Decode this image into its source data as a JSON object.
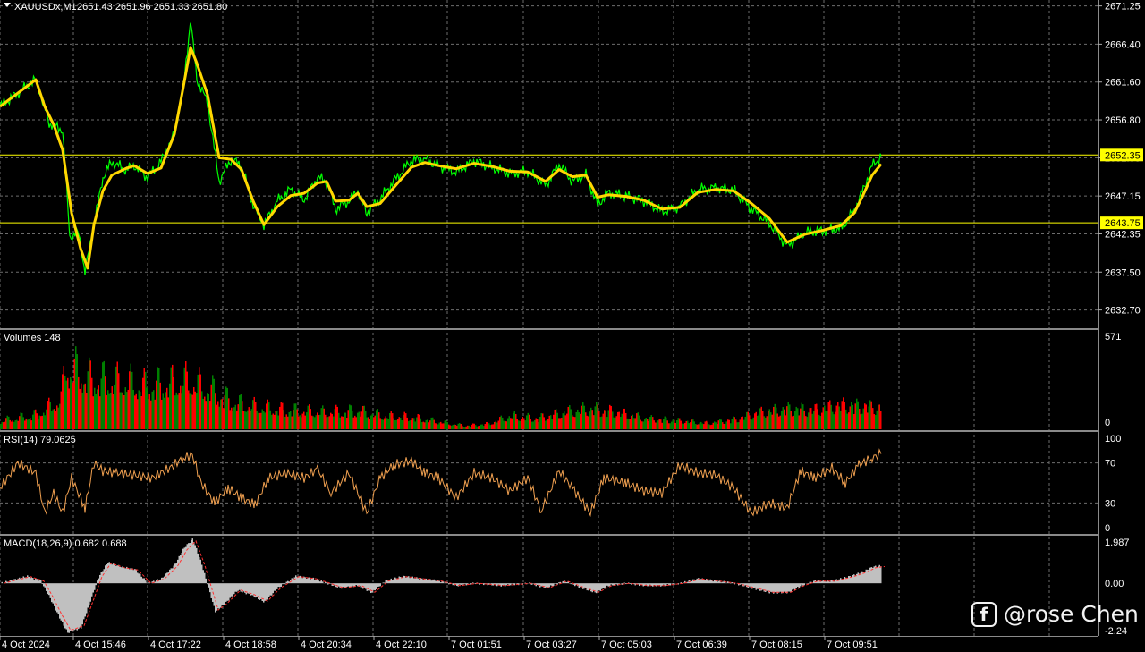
{
  "chart_data": [
    {
      "type": "line",
      "panel": "price",
      "header": {
        "symbol": "XAUUSDx,M1",
        "ohlc": "2651.43 2651.96 2651.33 2651.80"
      },
      "ylim": [
        2630.5,
        2672.0
      ],
      "y_ticks": [
        "2671.25",
        "2666.40",
        "2661.60",
        "2656.80",
        "2652.00",
        "2647.15",
        "2642.35",
        "2637.50",
        "2632.70"
      ],
      "x_ticks": [
        "4 Oct 2024",
        "4 Oct 15:46",
        "4 Oct 17:22",
        "4 Oct 18:58",
        "4 Oct 20:34",
        "4 Oct 22:10",
        "7 Oct 01:51",
        "7 Oct 03:27",
        "7 Oct 05:03",
        "7 Oct 06:39",
        "7 Oct 08:15",
        "7 Oct 09:51"
      ],
      "levels": [
        {
          "label": "2652.35",
          "value": 2652.35,
          "color": "#ffff00"
        },
        {
          "label": "2643.75",
          "value": 2643.75,
          "color": "#ffff00"
        }
      ],
      "series": [
        {
          "role": "price",
          "color": "#00ff00",
          "points": [
            [
              0,
              2658.5
            ],
            [
              40,
              2661.9
            ],
            [
              55,
              2656.4
            ],
            [
              70,
              2655.5
            ],
            [
              78,
              2642.0
            ],
            [
              88,
              2642.5
            ],
            [
              95,
              2637.5
            ],
            [
              105,
              2643.5
            ],
            [
              115,
              2649.5
            ],
            [
              125,
              2651.5
            ],
            [
              140,
              2650.5
            ],
            [
              150,
              2651.0
            ],
            [
              165,
              2649.5
            ],
            [
              180,
              2651.5
            ],
            [
              195,
              2655.0
            ],
            [
              205,
              2661.0
            ],
            [
              213,
              2669.5
            ],
            [
              220,
              2662.0
            ],
            [
              232,
              2659.0
            ],
            [
              245,
              2649.0
            ],
            [
              258,
              2651.8
            ],
            [
              270,
              2651.0
            ],
            [
              283,
              2646.0
            ],
            [
              295,
              2643.5
            ],
            [
              310,
              2646.5
            ],
            [
              325,
              2648.0
            ],
            [
              340,
              2646.7
            ],
            [
              355,
              2649.5
            ],
            [
              365,
              2649.0
            ],
            [
              375,
              2645.5
            ],
            [
              390,
              2646.5
            ],
            [
              400,
              2647.8
            ],
            [
              410,
              2645.0
            ],
            [
              425,
              2646.8
            ],
            [
              440,
              2649.0
            ],
            [
              460,
              2651.7
            ],
            [
              475,
              2651.8
            ],
            [
              490,
              2651.0
            ],
            [
              510,
              2650.2
            ],
            [
              530,
              2651.6
            ],
            [
              550,
              2650.8
            ],
            [
              570,
              2650.0
            ],
            [
              590,
              2650.3
            ],
            [
              610,
              2648.5
            ],
            [
              625,
              2651.2
            ],
            [
              640,
              2649.0
            ],
            [
              655,
              2649.8
            ],
            [
              668,
              2646.0
            ],
            [
              680,
              2647.6
            ],
            [
              700,
              2647.1
            ],
            [
              720,
              2646.6
            ],
            [
              740,
              2645.2
            ],
            [
              760,
              2645.8
            ],
            [
              780,
              2648.0
            ],
            [
              800,
              2648.2
            ],
            [
              820,
              2647.9
            ],
            [
              840,
              2645.5
            ],
            [
              860,
              2643.7
            ],
            [
              880,
              2640.8
            ],
            [
              900,
              2642.5
            ],
            [
              920,
              2642.8
            ],
            [
              940,
              2643.0
            ],
            [
              955,
              2645.3
            ],
            [
              965,
              2648.0
            ],
            [
              975,
              2651.0
            ],
            [
              985,
              2652.2
            ]
          ]
        },
        {
          "role": "moving-average",
          "color": "#ffd700",
          "points": [
            [
              0,
              2658.5
            ],
            [
              40,
              2661.9
            ],
            [
              50,
              2658.5
            ],
            [
              60,
              2656.2
            ],
            [
              70,
              2653.0
            ],
            [
              80,
              2645.0
            ],
            [
              90,
              2640.5
            ],
            [
              98,
              2638.0
            ],
            [
              105,
              2643.5
            ],
            [
              115,
              2647.8
            ],
            [
              125,
              2649.8
            ],
            [
              140,
              2650.6
            ],
            [
              150,
              2651.0
            ],
            [
              165,
              2650.0
            ],
            [
              180,
              2650.7
            ],
            [
              195,
              2655.0
            ],
            [
              205,
              2661.0
            ],
            [
              213,
              2666.0
            ],
            [
              220,
              2664.0
            ],
            [
              232,
              2660.0
            ],
            [
              245,
              2652.0
            ],
            [
              258,
              2651.8
            ],
            [
              270,
              2650.5
            ],
            [
              283,
              2646.5
            ],
            [
              295,
              2643.5
            ],
            [
              310,
              2645.8
            ],
            [
              325,
              2647.2
            ],
            [
              340,
              2647.5
            ],
            [
              355,
              2648.8
            ],
            [
              365,
              2649.0
            ],
            [
              375,
              2646.5
            ],
            [
              390,
              2646.6
            ],
            [
              400,
              2647.5
            ],
            [
              410,
              2645.8
            ],
            [
              425,
              2646.2
            ],
            [
              440,
              2648.2
            ],
            [
              460,
              2650.8
            ],
            [
              475,
              2651.4
            ],
            [
              490,
              2651.0
            ],
            [
              510,
              2650.6
            ],
            [
              530,
              2651.3
            ],
            [
              550,
              2650.9
            ],
            [
              570,
              2650.3
            ],
            [
              590,
              2650.2
            ],
            [
              610,
              2649.0
            ],
            [
              625,
              2650.5
            ],
            [
              640,
              2649.6
            ],
            [
              655,
              2649.8
            ],
            [
              668,
              2647.0
            ],
            [
              680,
              2647.3
            ],
            [
              700,
              2647.1
            ],
            [
              720,
              2646.6
            ],
            [
              740,
              2645.5
            ],
            [
              760,
              2645.7
            ],
            [
              780,
              2647.6
            ],
            [
              800,
              2648.0
            ],
            [
              820,
              2647.8
            ],
            [
              840,
              2646.2
            ],
            [
              860,
              2644.3
            ],
            [
              880,
              2641.3
            ],
            [
              900,
              2642.3
            ],
            [
              920,
              2642.8
            ],
            [
              940,
              2643.4
            ],
            [
              955,
              2645.0
            ],
            [
              965,
              2647.3
            ],
            [
              975,
              2649.8
            ],
            [
              985,
              2651.2
            ]
          ]
        }
      ]
    },
    {
      "type": "bar",
      "panel": "volumes",
      "label": "Volumes 148",
      "ylim": [
        0,
        571
      ],
      "y_ticks": [
        "571",
        "0"
      ],
      "colors": {
        "up": "#008000",
        "down": "#ff0000"
      },
      "envelope": [
        [
          0,
          70
        ],
        [
          40,
          120
        ],
        [
          68,
          250
        ],
        [
          72,
          530
        ],
        [
          85,
          480
        ],
        [
          100,
          420
        ],
        [
          120,
          400
        ],
        [
          140,
          390
        ],
        [
          160,
          360
        ],
        [
          190,
          380
        ],
        [
          210,
          400
        ],
        [
          240,
          310
        ],
        [
          260,
          220
        ],
        [
          290,
          180
        ],
        [
          320,
          160
        ],
        [
          360,
          140
        ],
        [
          400,
          150
        ],
        [
          430,
          110
        ],
        [
          460,
          100
        ],
        [
          500,
          50
        ],
        [
          520,
          30
        ],
        [
          545,
          45
        ],
        [
          570,
          110
        ],
        [
          600,
          90
        ],
        [
          630,
          140
        ],
        [
          660,
          170
        ],
        [
          690,
          140
        ],
        [
          720,
          90
        ],
        [
          760,
          70
        ],
        [
          790,
          50
        ],
        [
          820,
          80
        ],
        [
          850,
          140
        ],
        [
          880,
          170
        ],
        [
          910,
          160
        ],
        [
          940,
          200
        ],
        [
          985,
          180
        ]
      ]
    },
    {
      "type": "line",
      "panel": "rsi",
      "label": "RSI(14) 79.0625",
      "ylim": [
        0,
        100
      ],
      "y_ticks": [
        "100",
        "70",
        "30",
        "0"
      ],
      "color": "#f0a050",
      "points": [
        [
          0,
          45
        ],
        [
          20,
          70
        ],
        [
          40,
          60
        ],
        [
          50,
          20
        ],
        [
          60,
          40
        ],
        [
          70,
          20
        ],
        [
          80,
          55
        ],
        [
          95,
          25
        ],
        [
          105,
          70
        ],
        [
          115,
          62
        ],
        [
          130,
          60
        ],
        [
          150,
          58
        ],
        [
          170,
          55
        ],
        [
          190,
          65
        ],
        [
          205,
          75
        ],
        [
          215,
          78
        ],
        [
          225,
          50
        ],
        [
          240,
          30
        ],
        [
          255,
          45
        ],
        [
          270,
          35
        ],
        [
          285,
          28
        ],
        [
          300,
          55
        ],
        [
          320,
          60
        ],
        [
          340,
          55
        ],
        [
          355,
          64
        ],
        [
          370,
          40
        ],
        [
          390,
          60
        ],
        [
          410,
          20
        ],
        [
          425,
          55
        ],
        [
          440,
          68
        ],
        [
          460,
          72
        ],
        [
          475,
          60
        ],
        [
          490,
          55
        ],
        [
          510,
          35
        ],
        [
          530,
          60
        ],
        [
          550,
          55
        ],
        [
          570,
          42
        ],
        [
          590,
          55
        ],
        [
          605,
          22
        ],
        [
          625,
          62
        ],
        [
          640,
          45
        ],
        [
          660,
          20
        ],
        [
          675,
          55
        ],
        [
          700,
          50
        ],
        [
          720,
          42
        ],
        [
          740,
          40
        ],
        [
          760,
          68
        ],
        [
          780,
          60
        ],
        [
          800,
          58
        ],
        [
          820,
          45
        ],
        [
          840,
          20
        ],
        [
          860,
          30
        ],
        [
          880,
          25
        ],
        [
          895,
          62
        ],
        [
          910,
          55
        ],
        [
          930,
          65
        ],
        [
          945,
          50
        ],
        [
          960,
          68
        ],
        [
          975,
          75
        ],
        [
          985,
          79
        ]
      ]
    },
    {
      "type": "area",
      "panel": "macd",
      "label": "MACD(18,26,9) 0.682 0.688",
      "ylim": [
        -2.24,
        1.987
      ],
      "y_ticks": [
        "1.987",
        "0.00",
        "-2.24"
      ],
      "colors": {
        "histogram": "#c0c0c0",
        "signal": "#ff3030"
      },
      "points": [
        [
          0,
          0.0
        ],
        [
          30,
          0.3
        ],
        [
          45,
          0.1
        ],
        [
          55,
          -0.6
        ],
        [
          65,
          -1.4
        ],
        [
          75,
          -2.1
        ],
        [
          90,
          -1.9
        ],
        [
          100,
          -0.8
        ],
        [
          110,
          0.3
        ],
        [
          120,
          0.9
        ],
        [
          135,
          0.7
        ],
        [
          150,
          0.6
        ],
        [
          165,
          0.0
        ],
        [
          180,
          0.2
        ],
        [
          195,
          0.8
        ],
        [
          205,
          1.5
        ],
        [
          215,
          1.9
        ],
        [
          225,
          0.8
        ],
        [
          240,
          -1.2
        ],
        [
          250,
          -0.9
        ],
        [
          265,
          -0.3
        ],
        [
          280,
          -0.5
        ],
        [
          295,
          -0.8
        ],
        [
          310,
          -0.2
        ],
        [
          330,
          0.3
        ],
        [
          350,
          0.2
        ],
        [
          365,
          0.0
        ],
        [
          380,
          -0.2
        ],
        [
          400,
          -0.1
        ],
        [
          415,
          -0.4
        ],
        [
          430,
          0.1
        ],
        [
          450,
          0.3
        ],
        [
          470,
          0.2
        ],
        [
          490,
          0.1
        ],
        [
          510,
          -0.1
        ],
        [
          530,
          0.0
        ],
        [
          560,
          -0.1
        ],
        [
          590,
          0.0
        ],
        [
          610,
          -0.2
        ],
        [
          630,
          0.1
        ],
        [
          650,
          -0.2
        ],
        [
          665,
          -0.4
        ],
        [
          680,
          -0.1
        ],
        [
          700,
          0.0
        ],
        [
          720,
          -0.1
        ],
        [
          740,
          -0.1
        ],
        [
          760,
          0.0
        ],
        [
          780,
          0.2
        ],
        [
          800,
          0.1
        ],
        [
          820,
          0.0
        ],
        [
          840,
          -0.2
        ],
        [
          860,
          -0.4
        ],
        [
          880,
          -0.4
        ],
        [
          895,
          -0.1
        ],
        [
          910,
          0.1
        ],
        [
          930,
          0.1
        ],
        [
          950,
          0.3
        ],
        [
          965,
          0.5
        ],
        [
          975,
          0.7
        ],
        [
          985,
          0.75
        ]
      ]
    }
  ],
  "watermark": {
    "icon": "facebook-icon",
    "glyph": "f",
    "text": "@rose Chen"
  }
}
